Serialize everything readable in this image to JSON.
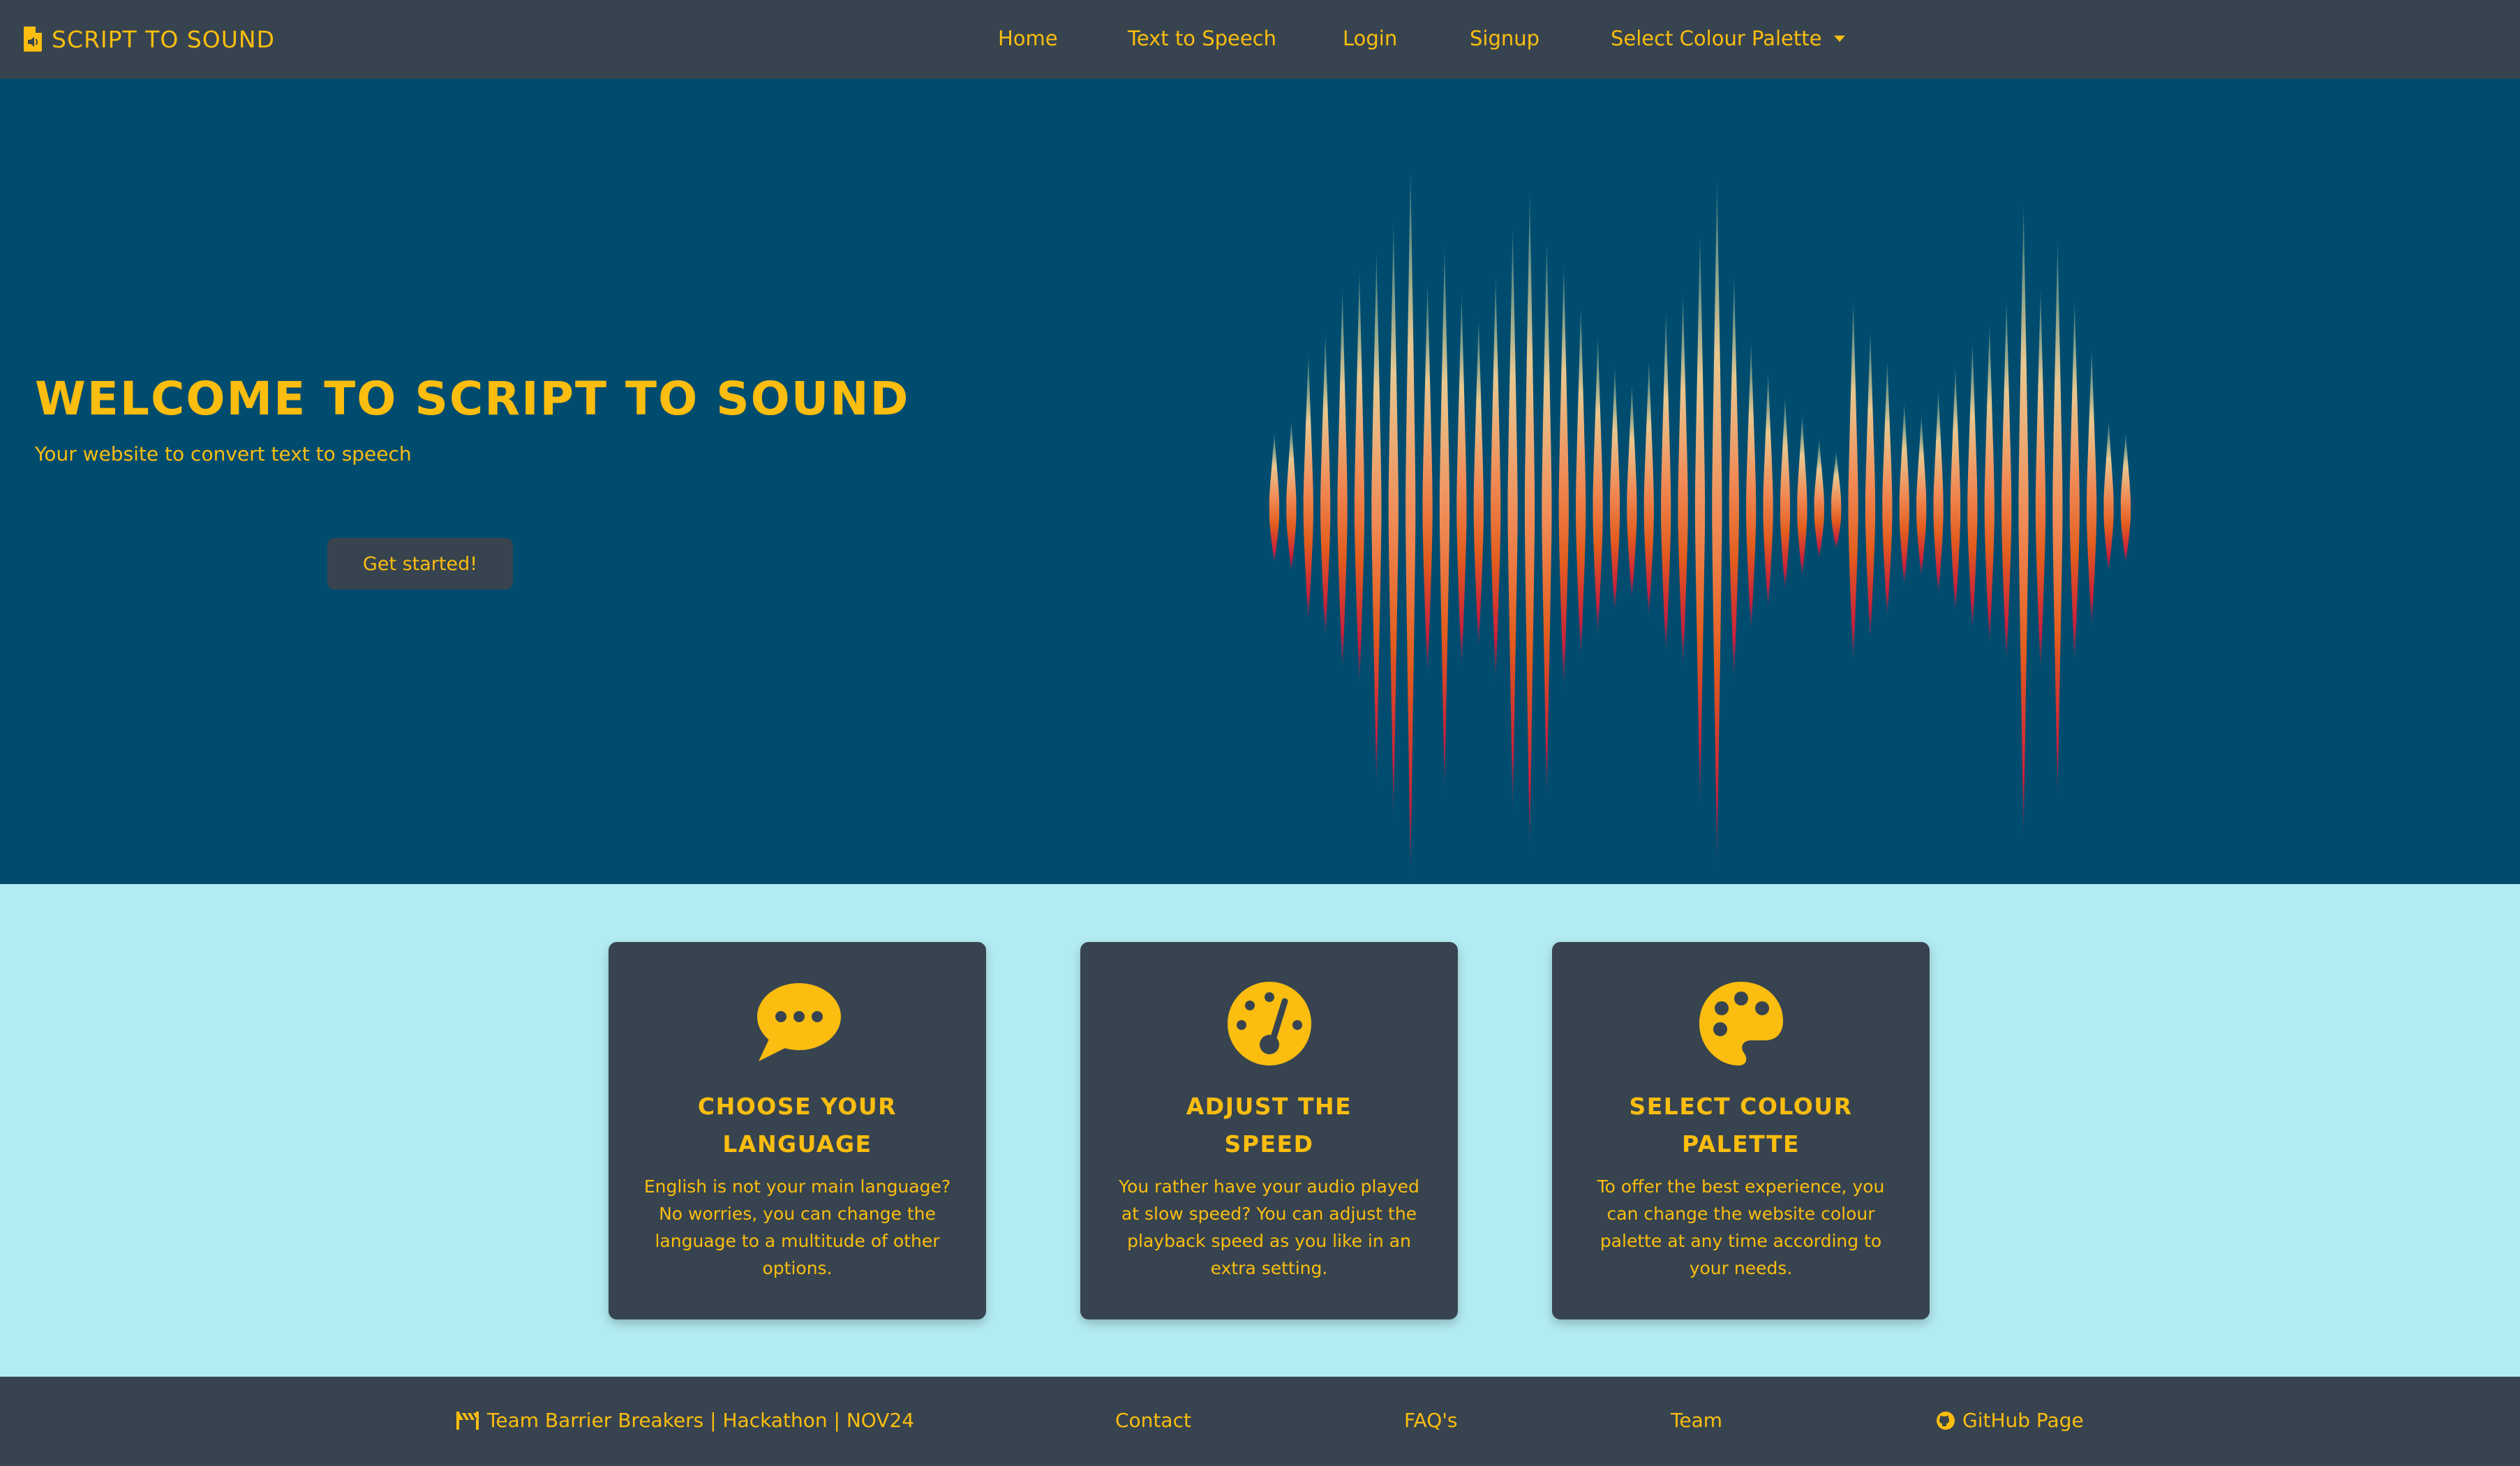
{
  "navbar": {
    "brand": "SCRIPT TO SOUND",
    "brand_icon": "file-audio-icon",
    "links": {
      "home": "Home",
      "text_to_speech": "Text to Speech",
      "login": "Login",
      "signup": "Signup",
      "palette": "Select Colour Palette"
    }
  },
  "hero": {
    "title": "WELCOME TO SCRIPT TO SOUND",
    "subtitle": "Your website to convert text to speech",
    "button": "Get started!",
    "image": "sound-waveform"
  },
  "features": [
    {
      "icon": "speech-bubble-icon",
      "title": "CHOOSE YOUR LANGUAGE",
      "text": "English is not your main language? No worries, you can change the language to a multitude of other options."
    },
    {
      "icon": "gauge-icon",
      "title": "ADJUST THE SPEED",
      "text": "You rather have your audio played at slow speed? You can adjust the playback speed as you like in an extra setting."
    },
    {
      "icon": "palette-icon",
      "title": "SELECT COLOUR PALETTE",
      "text": "To offer the best experience, you can change the website colour palette at any time according to your needs."
    }
  ],
  "footer": {
    "team": "Team Barrier Breakers | Hackathon | NOV24",
    "contact": "Contact",
    "faq": "FAQ's",
    "team_link": "Team",
    "github": "GitHub Page"
  },
  "colors": {
    "accent": "#fbbd0f",
    "navbar_bg": "#37444f",
    "hero_bg": "#004c6f",
    "features_bg": "#b3ebf2",
    "card_bg": "#37444f"
  }
}
